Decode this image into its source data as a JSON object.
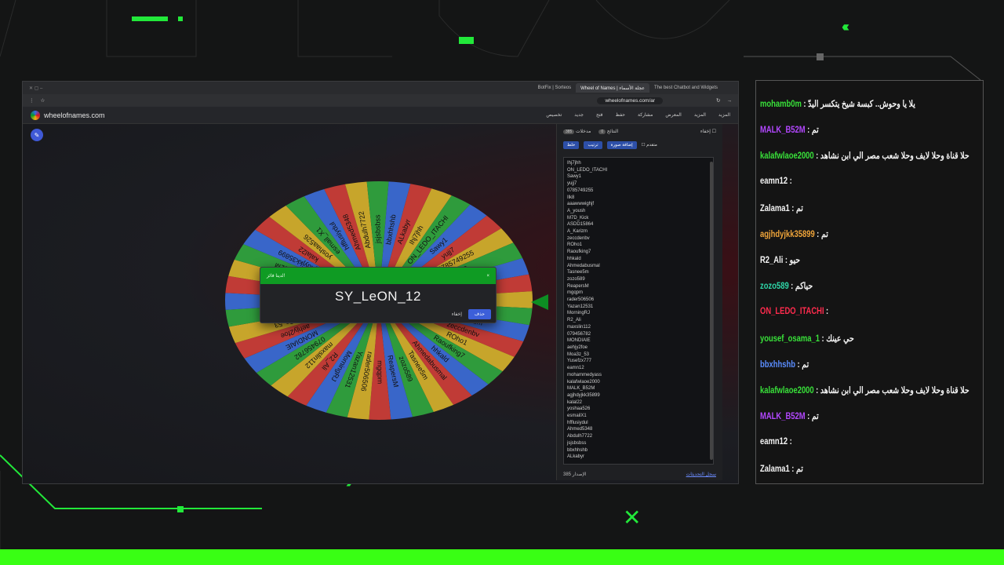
{
  "browser": {
    "tabs": [
      {
        "label": "BotFix | Sorteos",
        "active": false
      },
      {
        "label": "Wheel of Names | عجلة الأسماء",
        "active": true
      },
      {
        "label": "The best Chatbot and Widgets",
        "active": false
      }
    ],
    "url": "wheelofnames.com/ar",
    "app_title": "wheelofnames.com",
    "menu": [
      "المزيد",
      "المزيد",
      "المعرض",
      "مشاركة",
      "حفظ",
      "فتح",
      "جديد",
      "تخصيص"
    ]
  },
  "wheel": {
    "names": [
      "Ihj7jhh",
      "ON_LEDO_ITACHI",
      "Sawy1",
      "yujj7",
      "0785749255",
      "Ilk8",
      "aaawwwighjf",
      "A_yoush",
      "M7D_Kick",
      "ASDD15864",
      "A_Karizm",
      "zeccdenbv",
      "ROho1",
      "Raoufking7",
      "hhkald",
      "Ahmedabusmal",
      "Tasnee5m",
      "zozo589",
      "ReapersM",
      "mgqpm",
      "rader506506",
      "Yazan12531",
      "MorningRJ",
      "R2_Ali",
      "maxslin112",
      "079456782",
      "MONDIAIE",
      "aehjy2foe",
      "Moa3z_53",
      "Yusefzx777",
      "eamn12",
      "mohammedyass",
      "kalafwlaoe2000",
      "MALK_B52M",
      "agjhdyjkk35899",
      "kalal22",
      "yoshaa526",
      "esmail_X1",
      "hfflusiydul",
      "Ahmed5348",
      "Abdulh7722",
      "jsjsbsbss",
      "bbxhhshb",
      "ALkabyr"
    ],
    "colors": [
      "#c7a52b",
      "#2f9b3c",
      "#3966c9",
      "#c03b36"
    ]
  },
  "dialog": {
    "header": "لدينا فائز!",
    "winner": "SY_LeON_12",
    "close_label": "حذف",
    "remove_label": "إخفاء",
    "x": "×"
  },
  "panel": {
    "tab_entries": "مدخلات",
    "tab_entries_count": "385",
    "tab_results": "النتائج",
    "tab_results_count": "0",
    "hide_label": "إخفاء",
    "shuffle_label": "خلط",
    "sort_label": "ترتيب",
    "add_image_label": "إضافة صورة",
    "advanced_label": "متقدم",
    "entries": [
      "Ihj7jhh",
      "ON_LEDO_ITACHI",
      "Sawy1",
      "yujj7",
      "0785749255",
      "Ilk8",
      "aaawwwighjf",
      "A_yoush",
      "M7D_Kick",
      "ASDD15864",
      "A_Karizm",
      "zeccdenbv",
      "ROho1",
      "Raoufking7",
      "hhkald",
      "Ahmedabusmal",
      "Tasnee5m",
      "zozo589",
      "ReapersM",
      "mgqpm",
      "rader506506",
      "Yazan12531",
      "MorningRJ",
      "R2_Ali",
      "maxslin112",
      "079456782",
      "MONDIAIE",
      "aehjy2foe",
      "Moa3z_53",
      "Yusefzx777",
      "eamn12",
      "mohammedyass",
      "kalafwlaoe2000",
      "MALK_B52M",
      "agjhdyjkk35899",
      "kalal22",
      "yoshaa526",
      "esmailX1",
      "hfflusiydul",
      "Ahmed5348",
      "Abdulh7722",
      "jsjsbsbss",
      "bbxhhshb",
      "ALkabyr"
    ],
    "version_label": "الإصدار",
    "version": "385",
    "changelog_link": "سجل التحديثات"
  },
  "chat": [
    {
      "user": "mohamb0m",
      "sep": ":",
      "text": "يلا يا وحوش.. كبسة شيخ يتكسر اليدّ",
      "color": "#39e23a"
    },
    {
      "user": "MALK_B52M",
      "sep": ":",
      "text": "تم",
      "color": "#b347ff"
    },
    {
      "user": "kalafwlaoe2000",
      "sep": ":",
      "text": "حلا قناة وحلا لايف وحلا شعب مصر الي ابن نشاهد",
      "color": "#39e23a"
    },
    {
      "user": "eamn12",
      "sep": ":",
      "text": "",
      "color": "#f4f4f4"
    },
    {
      "user": "Zalama1",
      "sep": ":",
      "text": "تم",
      "color": "#f4f4f4"
    },
    {
      "user": "agjhdyjkk35899",
      "sep": ":",
      "text": "تم",
      "color": "#f0a53a"
    },
    {
      "user": "R2_Ali",
      "sep": ":",
      "text": "حيو",
      "color": "#f4f4f4"
    },
    {
      "user": "zozo589",
      "sep": ":",
      "text": "حياكم",
      "color": "#2ed6a8"
    },
    {
      "user": "ON_LEDO_ITACHI",
      "sep": ":",
      "text": "",
      "color": "#ff2b4d"
    },
    {
      "user": "yousef_osama_1",
      "sep": ":",
      "text": "حي عينك",
      "color": "#39e23a"
    },
    {
      "user": "bbxhhshb",
      "sep": ":",
      "text": "تم",
      "color": "#5a8dff"
    },
    {
      "user": "kalafwlaoe2000",
      "sep": ":",
      "text": "حلا قناة وحلا لايف وحلا شعب مصر الي ابن نشاهد",
      "color": "#39e23a"
    },
    {
      "user": "MALK_B52M",
      "sep": ":",
      "text": "تم",
      "color": "#b347ff"
    },
    {
      "user": "eamn12",
      "sep": ":",
      "text": "",
      "color": "#f4f4f4"
    },
    {
      "user": "Zalama1",
      "sep": ":",
      "text": "تم",
      "color": "#f4f4f4"
    }
  ],
  "icons": [
    "chevrons-left-icon",
    "chevrons-right-icon",
    "x-icon",
    "wheel-logo-icon",
    "edit-pencil-icon"
  ]
}
